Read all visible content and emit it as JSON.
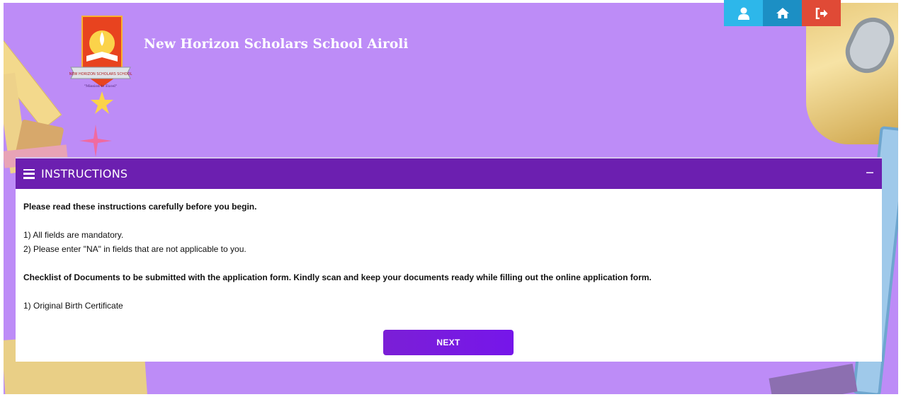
{
  "header": {
    "school_name": "New Horizon Scholars School Airoli",
    "logo_banner_text": "NEW HORIZON SCHOLARS SCHOOL",
    "logo_motto": "\"Mission to Excel\""
  },
  "top_buttons": [
    {
      "icon": "user-icon",
      "color": "#2db7ea"
    },
    {
      "icon": "home-icon",
      "color": "#1c8fc4"
    },
    {
      "icon": "logout-icon",
      "color": "#e04a36"
    }
  ],
  "instructions": {
    "title": "INSTRUCTIONS",
    "intro": "Please read these instructions carefully before you begin.",
    "rules": [
      "1) All fields are mandatory.",
      "2) Please enter \"NA\" in fields that are not applicable to you."
    ],
    "checklist_heading": "Checklist of Documents to be submitted with the application form. Kindly scan and keep your documents ready while filling out the online application form.",
    "documents": [
      "1) Original Birth Certificate"
    ],
    "next_label": "NEXT"
  },
  "colors": {
    "background": "#bd8cf7",
    "panel_header": "#6c1fb0",
    "next_button": "#7616ea"
  }
}
